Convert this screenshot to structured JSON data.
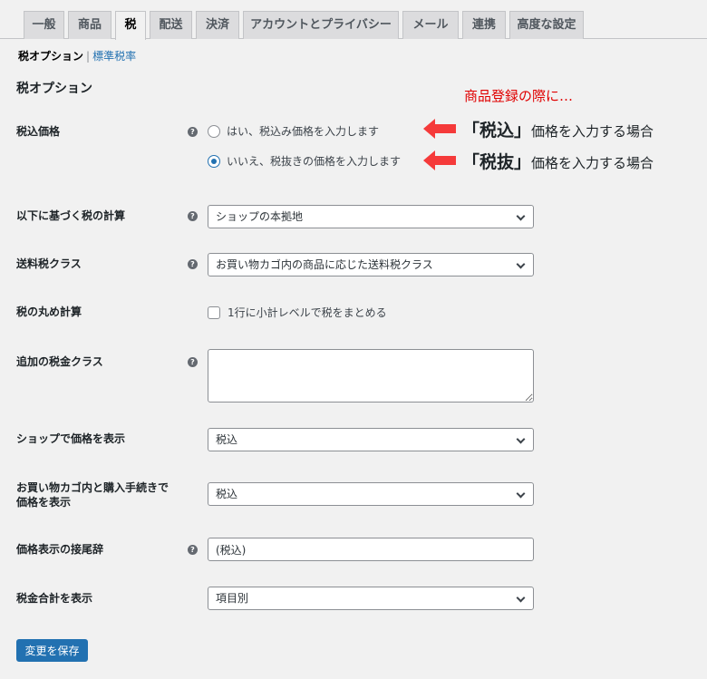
{
  "tabs": [
    "一般",
    "商品",
    "税",
    "配送",
    "決済",
    "アカウントとプライバシー",
    "メール",
    "連携",
    "高度な設定"
  ],
  "subnav": {
    "current": "税オプション",
    "separator": "|",
    "link": "標準税率"
  },
  "section_title": "税オプション",
  "fields": {
    "prices_entered": {
      "label": "税込価格",
      "options": [
        "はい、税込み価格を入力します",
        "いいえ、税抜きの価格を入力します"
      ],
      "selected_index": 1
    },
    "tax_based_on": {
      "label": "以下に基づく税の計算",
      "value": "ショップの本拠地"
    },
    "shipping_tax_class": {
      "label": "送料税クラス",
      "value": "お買い物カゴ内の商品に応じた送料税クラス"
    },
    "tax_round": {
      "label": "税の丸め計算",
      "checkbox_label": "1行に小計レベルで税をまとめる",
      "checked": false
    },
    "additional_tax_classes": {
      "label": "追加の税金クラス",
      "value": ""
    },
    "display_prices_shop": {
      "label": "ショップで価格を表示",
      "value": "税込"
    },
    "display_prices_cart": {
      "label_line1": "お買い物カゴ内と購入手続きで",
      "label_line2": "価格を表示",
      "value": "税込"
    },
    "price_suffix": {
      "label": "価格表示の接尾辞",
      "value": "(税込)"
    },
    "display_totals": {
      "label": "税金合計を表示",
      "value": "項目別"
    }
  },
  "help_icon_glyph": "?",
  "save_button": "変更を保存",
  "annotations": {
    "header": "商品登録の際に…",
    "line1": {
      "open": "「",
      "em": "税込",
      "close": "」",
      "rest": "価格を入力する場合"
    },
    "line2": {
      "open": "「",
      "em": "税抜",
      "close": "」",
      "rest": "価格を入力する場合"
    },
    "color": "#e00000",
    "arrow_color": "#f53a3a"
  },
  "colors": {
    "accent": "#2271b1",
    "background": "#f1f1f1"
  }
}
